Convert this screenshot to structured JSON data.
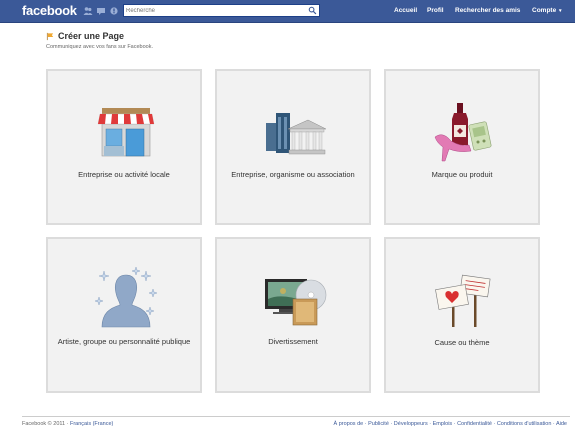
{
  "topbar": {
    "logo": "facebook",
    "search_placeholder": "Recherche",
    "nav": {
      "home": "Accueil",
      "profile": "Profil",
      "find_friends": "Rechercher des amis",
      "account": "Compte",
      "account_caret": "▾"
    }
  },
  "header": {
    "title": "Créer une Page",
    "subtitle": "Communiquez avec vos fans sur Facebook."
  },
  "categories": [
    {
      "label": "Entreprise ou activité locale",
      "icon": "storefront-icon"
    },
    {
      "label": "Entreprise, organisme ou association",
      "icon": "office-buildings-icon"
    },
    {
      "label": "Marque ou produit",
      "icon": "products-icon"
    },
    {
      "label": "Artiste, groupe ou personnalité publique",
      "icon": "star-silhouette-icon"
    },
    {
      "label": "Divertissement",
      "icon": "entertainment-icon"
    },
    {
      "label": "Cause ou thème",
      "icon": "protest-signs-icon"
    }
  ],
  "footer": {
    "copyright": "Facebook © 2011 · ",
    "language": "Français (France)",
    "links": [
      "À propos de",
      "Publicité",
      "Développeurs",
      "Emplois",
      "Confidentialité",
      "Conditions d'utilisation",
      "Aide"
    ],
    "separator": " · "
  },
  "colors": {
    "brand": "#3b5998",
    "tile_bg": "#f2f2f2",
    "tile_border": "#dcdcdc"
  }
}
